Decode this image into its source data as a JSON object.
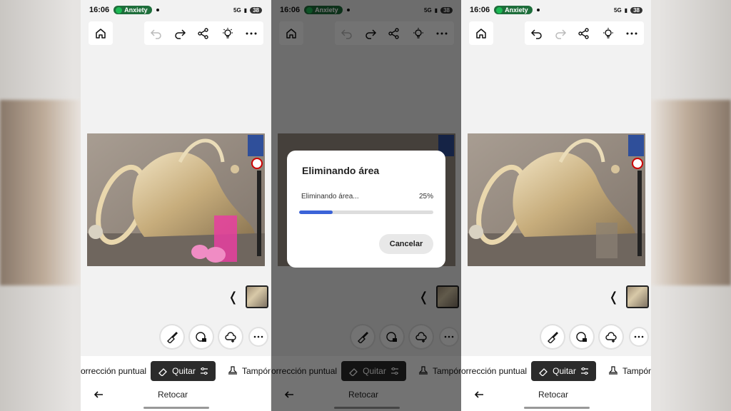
{
  "status": {
    "time": "16:06",
    "spotify_label": "Anxiety",
    "network": "5G",
    "battery": "38"
  },
  "modes": {
    "left": "orrección puntual",
    "active": "Quitar",
    "right": "Tampón"
  },
  "nav": {
    "title": "Retocar"
  },
  "dialog": {
    "title": "Eliminando área",
    "label": "Eliminando área...",
    "percent_text": "25%",
    "progress": 0.25,
    "cancel": "Cancelar"
  },
  "colors": {
    "accent": "#3b63d8",
    "active_mode_bg": "#2b2b2b",
    "pill": "#1e6e3b",
    "mask": "#e83ea0"
  },
  "icons": [
    "home-icon",
    "undo-icon",
    "redo-icon",
    "share-icon",
    "lightbulb-icon",
    "more-icon",
    "chevron-left-icon",
    "brush-icon",
    "brush-lock-icon",
    "cloud-add-icon",
    "eraser-icon",
    "sliders-icon",
    "stamp-icon",
    "arrow-left-icon"
  ]
}
